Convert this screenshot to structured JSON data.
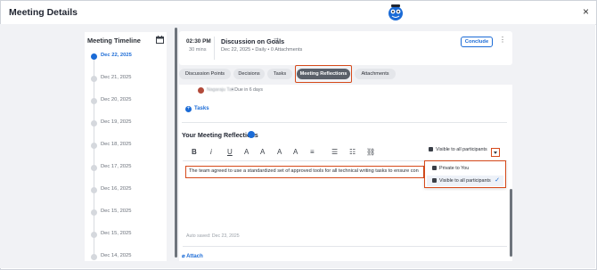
{
  "window": {
    "title": "Meeting Details",
    "close_glyph": "×"
  },
  "timeline": {
    "title": "Meeting Timeline",
    "dates": [
      "Dec 22, 2025",
      "Dec 21, 2025",
      "Dec 20, 2025",
      "Dec 19, 2025",
      "Dec 18, 2025",
      "Dec 17, 2025",
      "Dec 16, 2025",
      "Dec 15, 2025",
      "Dec 15, 2025",
      "Dec 14, 2025"
    ],
    "active_index": 0
  },
  "meeting": {
    "time": "02:30 PM",
    "duration": "30 mins",
    "title": "Discussion on Goals",
    "meta": "Dec 22, 2025 • Daily •  0  Attachments",
    "conclude_label": "Conclude",
    "more_glyph": "⋮",
    "sync_glyph": "⇄"
  },
  "tabs": [
    "Discussion Points",
    "Decisions",
    "Tasks",
    "Meeting Reflections",
    "Attachments"
  ],
  "active_tab": "Meeting Reflections",
  "task": {
    "assignee": "Nagaraju Tati",
    "due": "• Due in 6 days",
    "tasks_link": "Tasks"
  },
  "reflections": {
    "title": "Your Meeting Reflections",
    "toolbar": [
      "B",
      "i",
      "U",
      "A",
      "A",
      "A",
      "A",
      "≡",
      "☰",
      "☷",
      "⛓"
    ],
    "visibility_label": "Visible to all participants",
    "text": "The team agreed to use a standardized set of approved tools for all technical writing tasks to ensure con",
    "autosaved": "Auto saved: Dec 23, 2025",
    "attach_label": "Attach"
  },
  "visibility_menu": {
    "options": [
      "Private to You",
      "Visible to all participants"
    ],
    "selected": "Visible to all participants",
    "check_glyph": "✓"
  },
  "colors": {
    "accent": "#1b6bd6",
    "highlight": "#d64a1b",
    "tab_active": "#5a6069"
  }
}
